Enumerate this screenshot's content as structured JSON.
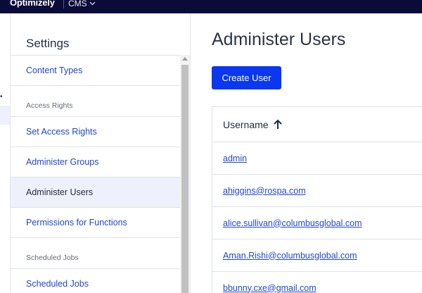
{
  "topbar": {
    "brand": "Optimizely",
    "app_switch_label": "CMS",
    "app_switch_icon": "chevron-down-icon"
  },
  "rail": {
    "dot": "•"
  },
  "sidebar": {
    "title": "Settings",
    "items": [
      {
        "type": "link",
        "label": "Content Types"
      },
      {
        "type": "heading",
        "label": "Access Rights"
      },
      {
        "type": "link",
        "label": "Set Access Rights"
      },
      {
        "type": "link",
        "label": "Administer Groups"
      },
      {
        "type": "link",
        "label": "Administer Users",
        "active": true
      },
      {
        "type": "link",
        "label": "Permissions for Functions"
      },
      {
        "type": "heading",
        "label": "Scheduled Jobs"
      },
      {
        "type": "link",
        "label": "Scheduled Jobs"
      }
    ]
  },
  "main": {
    "title": "Administer Users",
    "create_button": "Create User",
    "table": {
      "column_header": "Username",
      "sort_icon": "arrow-up-icon",
      "rows": [
        "admin",
        "ahiggins@rospa.com",
        "alice.sullivan@columbusglobal.com",
        "Aman.Rishi@columbusglobal.com",
        "bbunny.cxe@gmail.com"
      ]
    }
  },
  "colors": {
    "topbar_bg": "#0b0b3a",
    "primary_button": "#0a37ef",
    "link": "#2346c9",
    "active_item_bg": "#eef0fb"
  }
}
